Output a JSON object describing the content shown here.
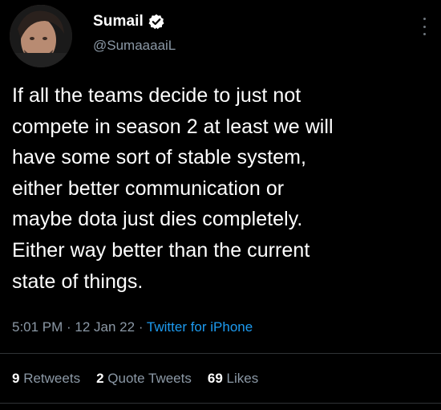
{
  "author": {
    "display_name": "Sumail",
    "handle": "@SumaaaaiL"
  },
  "icons": {
    "verified": "verified-badge-icon",
    "more": "more-vertical-icon"
  },
  "tweet": {
    "lines": [
      "If all the teams decide to just not",
      "compete in season 2 at least we will",
      "have some sort of stable system,",
      "either better communication or",
      "maybe dota just dies completely.",
      "Either way better than the current",
      "state of things."
    ],
    "time": "5:01 PM",
    "sep1": " · ",
    "date": "12 Jan 22",
    "sep2": " · ",
    "source": "Twitter for iPhone"
  },
  "stats": {
    "retweets_count": "9",
    "retweets_label": "Retweets",
    "quotes_count": "2",
    "quotes_label": "Quote Tweets",
    "likes_count": "69",
    "likes_label": "Likes"
  },
  "colors": {
    "background": "#000000",
    "text": "#ffffff",
    "secondary": "#8b98a5",
    "link": "#1d9bf0",
    "divider": "#2f3336"
  }
}
